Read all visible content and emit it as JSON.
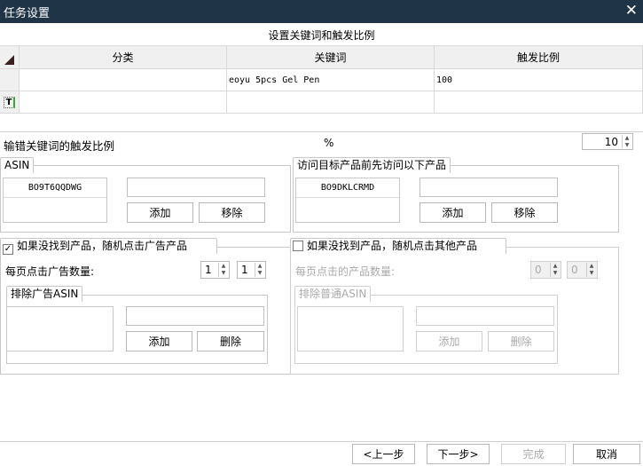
{
  "window": {
    "title": "任务设置",
    "close": "✕"
  },
  "grid": {
    "caption": "设置关键词和触发比例",
    "columns": [
      "分类",
      "关键词",
      "触发比例"
    ],
    "rows": [
      {
        "category": "",
        "keyword": "eoyu 5pcs Gel Pen",
        "ratio": "100"
      }
    ],
    "new_row_icon": "T"
  },
  "mistype": {
    "label": "输错关键词的触发比例",
    "unit": "%",
    "value": "10"
  },
  "asin": {
    "legend": "ASIN",
    "items": [
      "BO9T6QQDWG"
    ],
    "input": "",
    "add": "添加",
    "remove": "移除"
  },
  "pre_visit": {
    "legend": "访问目标产品前先访问以下产品",
    "items": [
      "BO9DKLCRMD"
    ],
    "input": "",
    "add": "添加",
    "remove": "移除"
  },
  "ad_click": {
    "checked": true,
    "check_mark": "✓",
    "legend": "如果没找到产品，随机点击广告产品",
    "count_label": "每页点击广告数量:",
    "min": "1",
    "max": "1",
    "exclude": {
      "legend": "排除广告ASIN",
      "add": "添加",
      "delete": "删除"
    }
  },
  "other_click": {
    "checked": false,
    "legend": "如果没找到产品，随机点击其他产品",
    "count_label": "每页点击的产品数量:",
    "min": "0",
    "max": "0",
    "exclude": {
      "legend": "排除普通ASIN",
      "add": "添加",
      "delete": "删除"
    }
  },
  "footer": {
    "prev": "<上一步",
    "next": "下一步>",
    "finish": "完成",
    "cancel": "取消"
  }
}
